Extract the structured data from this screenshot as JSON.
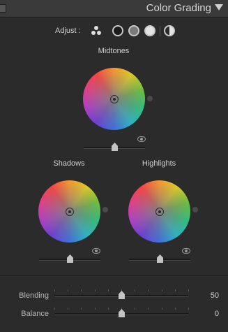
{
  "header": {
    "title": "Color Grading"
  },
  "adjust": {
    "label": "Adjust :",
    "modes": [
      "three-way-icon",
      "shadows-icon",
      "midtones-icon",
      "highlights-icon",
      "global-icon"
    ]
  },
  "wheels": {
    "midtones": {
      "label": "Midtones",
      "luminance": 0.5
    },
    "shadows": {
      "label": "Shadows",
      "luminance": 0.5
    },
    "highlights": {
      "label": "Highlights",
      "luminance": 0.5
    }
  },
  "blending": {
    "label": "Blending",
    "value": "50",
    "level": 0.5
  },
  "balance": {
    "label": "Balance",
    "value": "0",
    "level": 0.5
  }
}
